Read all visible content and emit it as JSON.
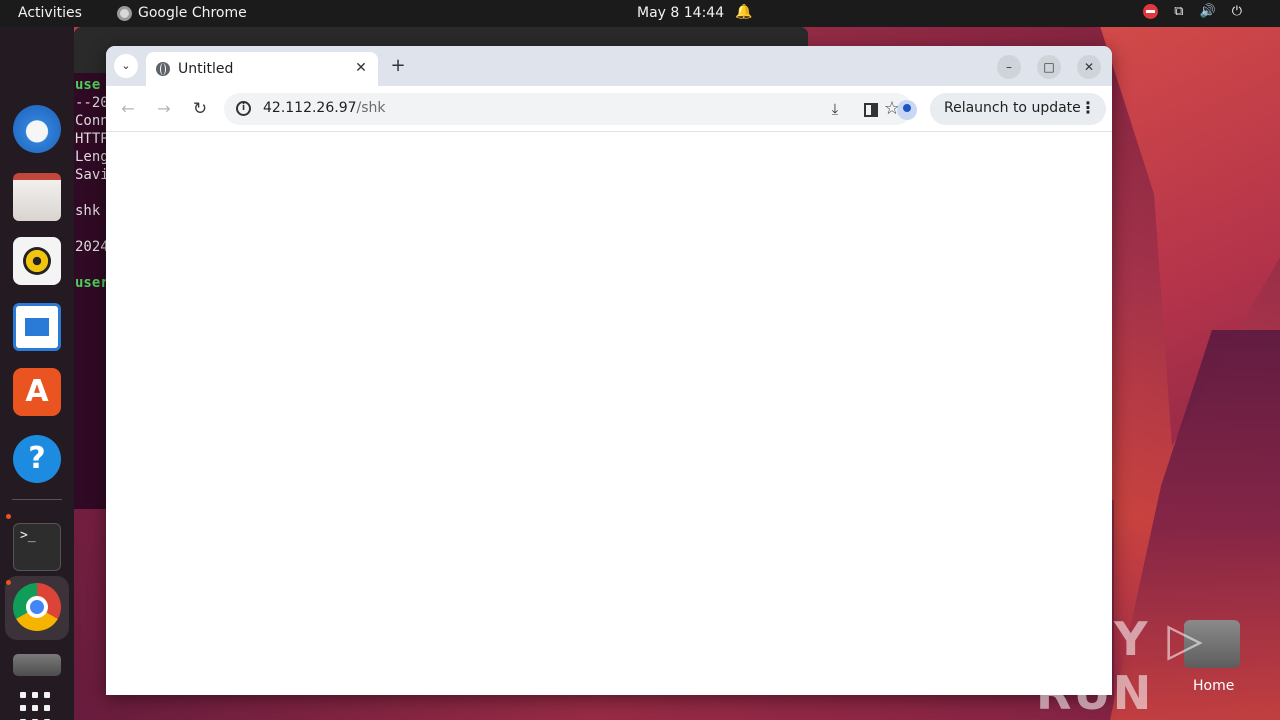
{
  "topbar": {
    "activities": "Activities",
    "app_name": "Google Chrome",
    "clock": "May 8  14:44"
  },
  "terminal": {
    "lines": [
      {
        "text": "use",
        "style": "green"
      },
      {
        "text": "--20",
        "style": ""
      },
      {
        "text": "Conn",
        "style": ""
      },
      {
        "text": "HTTP",
        "style": ""
      },
      {
        "text": "Leng",
        "style": ""
      },
      {
        "text": "Savi",
        "style": ""
      },
      {
        "text": "",
        "style": ""
      },
      {
        "text": "shk",
        "style": ""
      },
      {
        "text": "",
        "style": ""
      },
      {
        "text": "2024",
        "style": ""
      },
      {
        "text": "",
        "style": ""
      },
      {
        "text": "user",
        "style": "green"
      }
    ]
  },
  "chrome": {
    "tab_title": "Untitled",
    "new_tab_glyph": "+",
    "url_host": "42.112.26.97",
    "url_path": "/shk",
    "relaunch_label": "Relaunch to update"
  },
  "desktop": {
    "watermark": "ANY ▷ RUN",
    "home_label": "Home"
  },
  "icons": {
    "accent": "#e95420",
    "tab_bg": "#dfe3eb"
  }
}
